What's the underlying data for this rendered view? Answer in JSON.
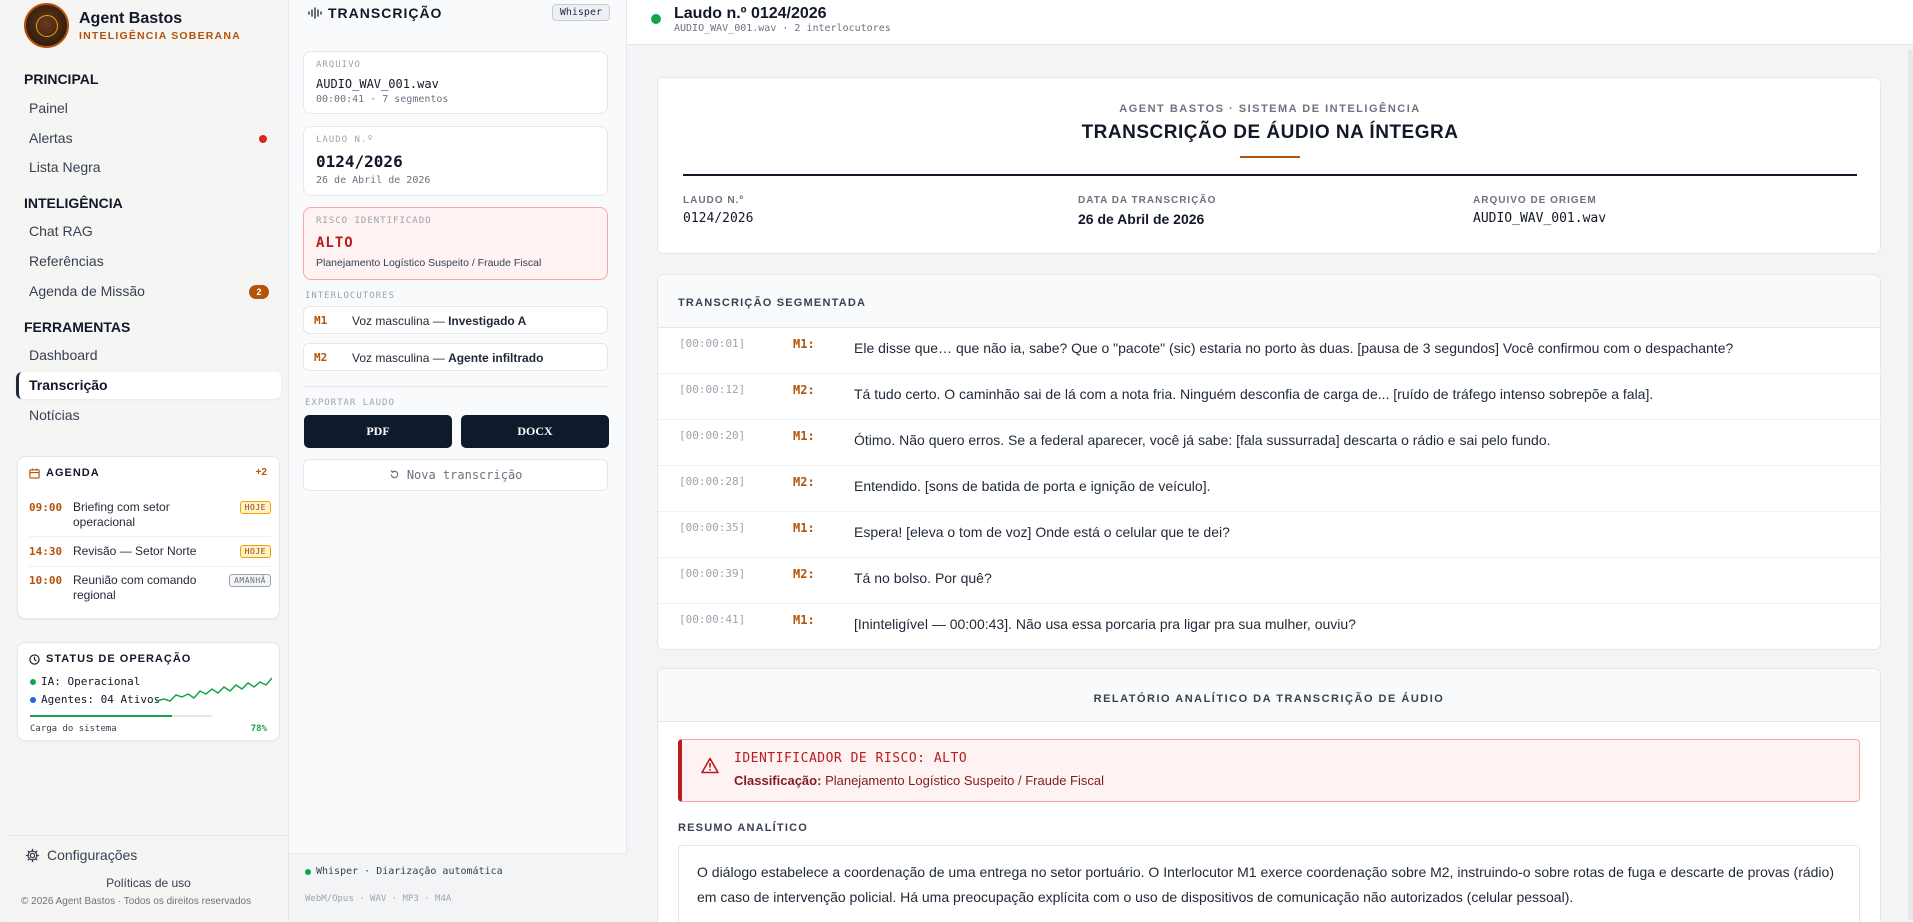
{
  "brand": {
    "name": "Agent Bastos",
    "subtitle": "INTELIGÊNCIA SOBERANA"
  },
  "nav": {
    "principal_title": "PRINCIPAL",
    "principal": [
      "Painel",
      "Alertas",
      "Lista Negra"
    ],
    "inteligencia_title": "INTELIGÊNCIA",
    "inteligencia": [
      "Chat RAG",
      "Referências",
      "Agenda de Missão"
    ],
    "agenda_badge": "2",
    "ferramentas_title": "FERRAMENTAS",
    "ferramentas": [
      "Dashboard",
      "Transcrição",
      "Notícias"
    ]
  },
  "agenda": {
    "title": "AGENDA",
    "more": "+2",
    "items": [
      {
        "time": "09:00",
        "text": "Briefing com setor operacional",
        "tag": "HOJE"
      },
      {
        "time": "14:30",
        "text": "Revisão — Setor Norte",
        "tag": "HOJE"
      },
      {
        "time": "10:00",
        "text": "Reunião com comando regional",
        "tag": "AMANHÃ"
      }
    ]
  },
  "status": {
    "title": "STATUS DE OPERAÇÃO",
    "ia": "IA: Operacional",
    "agentes": "Agentes: 04 Ativos",
    "load_label": "Carga do sistema",
    "load_value": "78%",
    "load_fraction": 0.78,
    "colors": {
      "ok": "#16a34a",
      "agents": "#2563eb"
    }
  },
  "footer": {
    "config": "Configurações",
    "policy": "Políticas de uso",
    "copyright": "© 2026 Agent Bastos · Todos os direitos reservados"
  },
  "panel": {
    "title": "TRANSCRIÇÃO",
    "engine": "Whisper",
    "file_label": "ARQUIVO",
    "file_name": "AUDIO_WAV_001.wav",
    "file_meta": "00:00:41 · 7 segmentos",
    "report_label": "LAUDO N.º",
    "report_number": "0124/2026",
    "report_date": "26 de Abril de 2026",
    "risk_label": "RISCO IDENTIFICADO",
    "risk_value": "ALTO",
    "risk_desc": "Planejamento Logístico Suspeito / Fraude Fiscal",
    "speakers_label": "INTERLOCUTORES",
    "speakers": [
      {
        "code": "M1",
        "desc": "Voz masculina —",
        "name": "Investigado A"
      },
      {
        "code": "M2",
        "desc": "Voz masculina —",
        "name": "Agente infiltrado"
      }
    ],
    "export_label": "EXPORTAR LAUDO",
    "export_pdf": "PDF",
    "export_docx": "DOCX",
    "new_transcription": "Nova transcrição",
    "footer_engine": "Whisper · Diarização automática",
    "footer_formats": "WebM/Opus · WAV · MP3 · M4A"
  },
  "main": {
    "title": "Laudo n.º 0124/2026",
    "subtitle": "AUDIO_WAV_001.wav · 2 interlocutores",
    "doc": {
      "org": "AGENT BASTOS · SISTEMA DE INTELIGÊNCIA",
      "title": "TRANSCRIÇÃO DE ÁUDIO NA ÍNTEGRA",
      "meta": [
        {
          "label": "LAUDO N.º",
          "value": "0124/2026"
        },
        {
          "label": "DATA DA TRANSCRIÇÃO",
          "value": "26 de Abril de 2026"
        },
        {
          "label": "ARQUIVO DE ORIGEM",
          "value": "AUDIO_WAV_001.wav"
        }
      ]
    },
    "segments_title": "TRANSCRIÇÃO SEGMENTADA",
    "segments": [
      {
        "time": "[00:00:01]",
        "speaker": "M1:",
        "text": "Ele disse que… que não ia, sabe? Que o \"pacote\" (sic) estaria no porto às duas. [pausa de 3 segundos] Você confirmou com o despachante?"
      },
      {
        "time": "[00:00:12]",
        "speaker": "M2:",
        "text": "Tá tudo certo. O caminhão sai de lá com a nota fria. Ninguém desconfia de carga de... [ruído de tráfego intenso sobrepõe a fala]."
      },
      {
        "time": "[00:00:20]",
        "speaker": "M1:",
        "text": "Ótimo. Não quero erros. Se a federal aparecer, você já sabe: [fala sussurrada] descarta o rádio e sai pelo fundo."
      },
      {
        "time": "[00:00:28]",
        "speaker": "M2:",
        "text": "Entendido. [sons de batida de porta e ignição de veículo]."
      },
      {
        "time": "[00:00:35]",
        "speaker": "M1:",
        "text": "Espera! [eleva o tom de voz] Onde está o celular que te dei?"
      },
      {
        "time": "[00:00:39]",
        "speaker": "M2:",
        "text": "Tá no bolso. Por quê?"
      },
      {
        "time": "[00:00:41]",
        "speaker": "M1:",
        "text": "[Ininteligível — 00:00:43]. Não usa essa porcaria pra ligar pra sua mulher, ouviu?"
      }
    ],
    "report_title": "RELATÓRIO ANALÍTICO DA TRANSCRIÇÃO DE ÁUDIO",
    "risk_heading": "IDENTIFICADOR DE RISCO: ALTO",
    "classification_label": "Classificação:",
    "classification_value": "Planejamento Logístico Suspeito / Fraude Fiscal",
    "summary_label": "RESUMO ANALÍTICO",
    "summary_text": "O diálogo estabelece a coordenação de uma entrega no setor portuário. O Interlocutor M1 exerce coordenação sobre M2, instruindo-o sobre rotas de fuga e descarte de provas (rádio) em caso de intervenção policial. Há uma preocupação explícita com o uso de dispositivos de comunicação não autorizados (celular pessoal)."
  },
  "colors": {
    "accent": "#b45309",
    "navy": "#0f1b2d",
    "risk": "#b91c1c",
    "online": "#16a34a"
  }
}
